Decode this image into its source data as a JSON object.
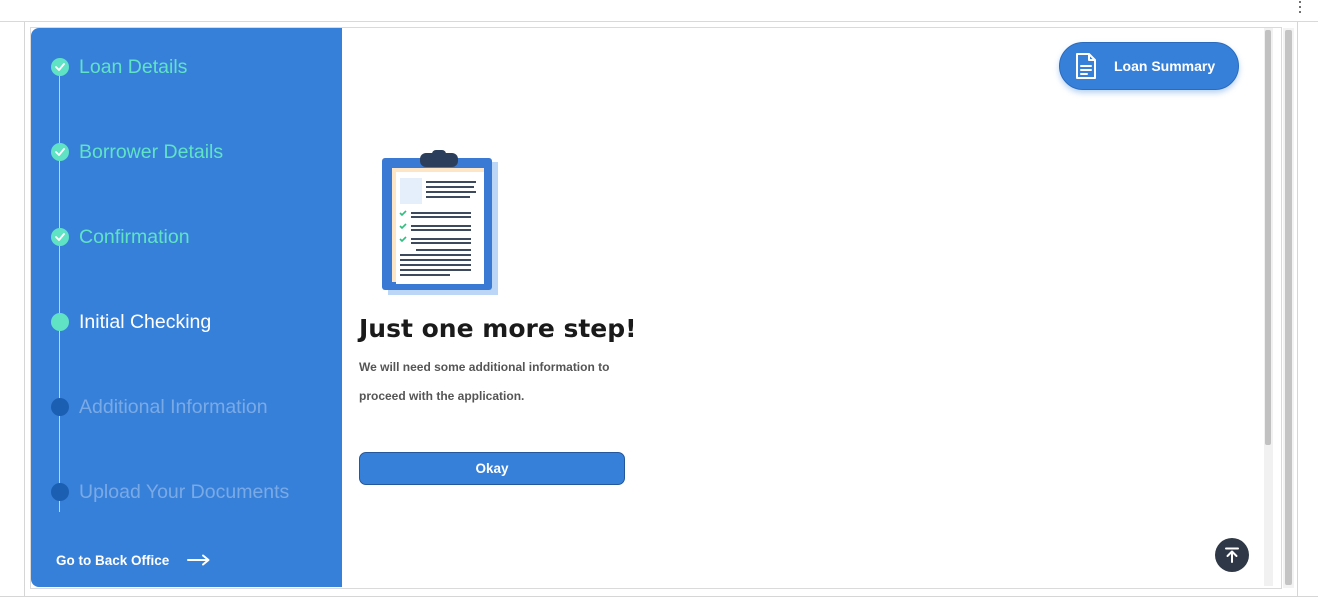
{
  "steps": [
    {
      "label": "Loan Details",
      "status": "done"
    },
    {
      "label": "Borrower Details",
      "status": "done"
    },
    {
      "label": "Confirmation",
      "status": "done"
    },
    {
      "label": "Initial Checking",
      "status": "current"
    },
    {
      "label": "Additional Information",
      "status": "pending"
    },
    {
      "label": "Upload Your Documents",
      "status": "pending"
    }
  ],
  "sidebar": {
    "back_office_label": "Go to Back Office"
  },
  "header": {
    "summary_label": "Loan Summary"
  },
  "main": {
    "title": "Just one more step!",
    "description_line1": "We will need some additional information to",
    "description_line2": "proceed with the application.",
    "okay_label": "Okay"
  },
  "icons": {
    "check": "check-icon",
    "arrow": "arrow-right-icon",
    "document": "document-icon",
    "clipboard": "clipboard-illustration",
    "scroll_top": "arrow-up-to-line-icon",
    "kebab": "more-vertical-icon"
  },
  "colors": {
    "sidebar": "#3780d9",
    "done": "#5fe3c4",
    "pending_dot": "#1b5fb2",
    "pending_text": "#7aaae6",
    "button": "#3780d9",
    "scroll_top": "#2e3846"
  }
}
